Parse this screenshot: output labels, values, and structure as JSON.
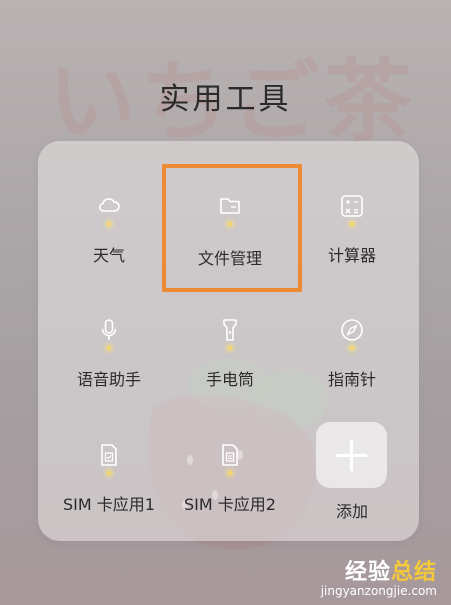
{
  "folder": {
    "title": "实用工具"
  },
  "apps": [
    {
      "label": "天气",
      "icon": "cloud-icon"
    },
    {
      "label": "文件管理",
      "icon": "folder-icon"
    },
    {
      "label": "计算器",
      "icon": "calculator-icon"
    },
    {
      "label": "语音助手",
      "icon": "microphone-icon"
    },
    {
      "label": "手电筒",
      "icon": "flashlight-icon"
    },
    {
      "label": "指南针",
      "icon": "compass-icon"
    },
    {
      "label": "SIM 卡应用1",
      "icon": "sim-card-icon"
    },
    {
      "label": "SIM 卡应用2",
      "icon": "sim-card-icon"
    },
    {
      "label": "添加",
      "icon": "plus-icon"
    }
  ],
  "highlight": {
    "target": "文件管理",
    "color": "#ef8a34"
  },
  "background": {
    "art_text": "いちご茶"
  },
  "watermark": {
    "main_1": "经验",
    "main_2": "总结",
    "url": "jingyanzongjie.com"
  }
}
